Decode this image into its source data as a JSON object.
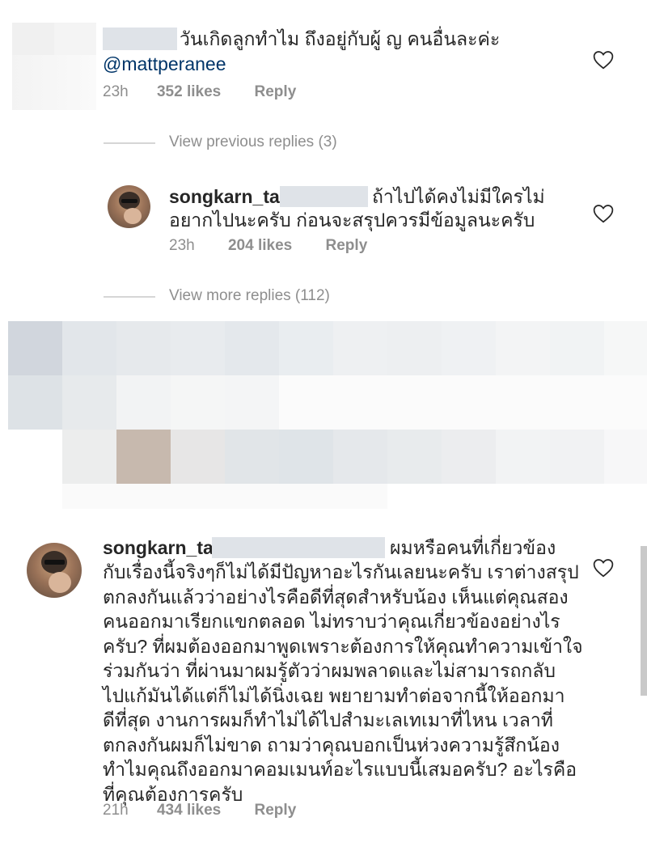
{
  "comments": [
    {
      "text_line1": "วันเกิดลูกทำไม ถึงอยู่กับผู้ ญ คนอื่นละค่ะ",
      "mention": "@mattperanee",
      "time": "23h",
      "likes": "352 likes",
      "reply": "Reply"
    }
  ],
  "replies_thread": {
    "view_previous": "View previous replies (3)",
    "reply": {
      "username": "songkarn_tae",
      "text_line1": "ถ้าไปได้คงไม่มีใครไม่",
      "text_line2": "อยากไปนะครับ ก่อนจะสรุปควรมีข้อมูลนะครับ",
      "time": "23h",
      "likes": "204 likes",
      "reply": "Reply"
    },
    "view_more": "View more replies (112)"
  },
  "main_comment": {
    "username": "songkarn_tae",
    "lines": [
      "ผมหรือคนที่เกี่ยวข้อง",
      "กับเรื่องนี้จริงๆก็ไม่ได้มีปัญหาอะไรกันเลยนะครับ เราต่างสรุป",
      "ตกลงกันแล้วว่าอย่างไรคือดีที่สุดสำหรับน้อง เห็นแต่คุณสอง",
      "คนออกมาเรียกแขกตลอด ไม่ทราบว่าคุณเกี่ยวข้องอย่างไร",
      "ครับ? ที่ผมต้องออกมาพูดเพราะต้องการให้คุณทำความเข้าใจ",
      "ร่วมกันว่า ที่ผ่านมาผมรู้ตัวว่าผมพลาดและไม่สามารถกลับ",
      "ไปแก้มันได้แต่ก็ไม่ได้นิ่งเฉย พยายามทำต่อจากนี้ให้ออกมา",
      "ดีที่สุด งานการผมก็ทำไม่ได้ไปสำมะเลเทเมาที่ไหน เวลาที่",
      "ตกลงกันผมก็ไม่ขาด ถามว่าคุณบอกเป็นห่วงความรู้สึกน้อง",
      "ทำไมคุณถึงออกมาคอมเมนท์อะไรแบบนี้เสมอครับ? อะไรคือ",
      "ที่คุณต้องการครับ"
    ],
    "time": "21h",
    "likes": "434 likes",
    "reply": "Reply"
  },
  "icons": {
    "heart": "heart-outline-icon",
    "avatar": "profile-avatar"
  },
  "colors": {
    "text": "#262626",
    "meta": "#8e8e8e",
    "mention": "#003569",
    "redaction": "#dfe3e8"
  }
}
